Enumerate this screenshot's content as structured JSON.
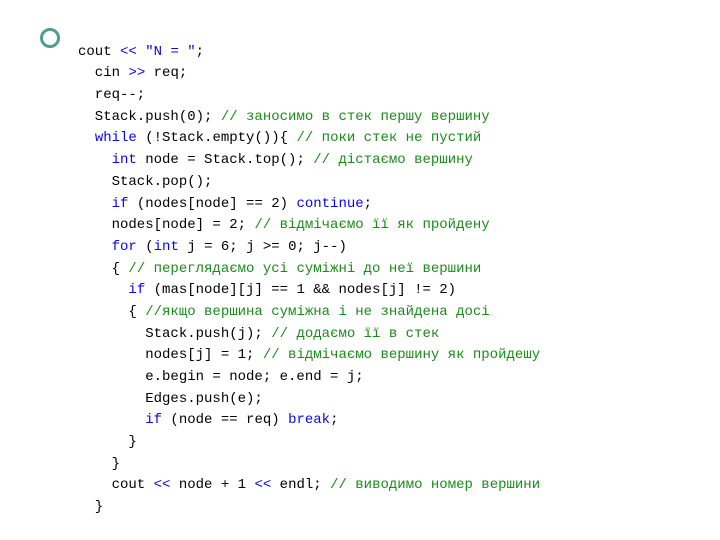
{
  "t": {
    "cout": "cout ",
    "ltlt1": "<< ",
    "str_n": "\"N = \"",
    "semi1": ";",
    "cin": "  cin ",
    "gtgt": ">> ",
    "req1": "req;",
    "req2": "  req--;",
    "push0": "  Stack.push(0); ",
    "cm_push0": "// заносимо в стек першу вершину",
    "while_sp": "  ",
    "while": "while",
    "while_cond": " (!Stack.empty()){ ",
    "cm_while": "// поки стек не пустий",
    "int_sp": "    ",
    "int": "int",
    "node_top": " node = Stack.top(); ",
    "cm_top": "// дістаємо вершину",
    "pop": "    Stack.pop();",
    "if1_sp": "    ",
    "if": "if",
    "if1_cond": " (nodes[node] == 2) ",
    "continue": "continue",
    "semi2": ";",
    "mark2": "    nodes[node] = 2; ",
    "cm_mark2": "// відмічаємо її як пройдену",
    "for_sp": "    ",
    "for": "for",
    "for_a": " (",
    "for_b": " j = 6; j >= 0; j--)",
    "brace1": "    { ",
    "cm_for": "// переглядаємо усі суміжні до неї вершини",
    "if2_sp": "      ",
    "if2_cond": " (mas[node][j] == 1 && nodes[j] != 2)",
    "brace2": "      { ",
    "cm_if2": "//якщо вершина суміжна і не знайдена досі",
    "pushj": "        Stack.push(j); ",
    "cm_pushj": "// додаємо її в стек",
    "nodesj": "        nodes[j] = 1; ",
    "cm_nodesj": "// відмічаємо вершину як пройдешу",
    "edge": "        e.begin = node; e.end = j;",
    "edges": "        Edges.push(e);",
    "if3_sp": "        ",
    "if3_cond": " (node == req) ",
    "break": "break",
    "semi3": ";",
    "cbrace1": "      }",
    "cbrace2": "    }",
    "cout2_sp": "    cout ",
    "ltlt2": "<<",
    "node1": " node + 1 ",
    "endl": " endl; ",
    "cm_out": "// виводимо номер вершини",
    "cbrace3": "  }"
  }
}
